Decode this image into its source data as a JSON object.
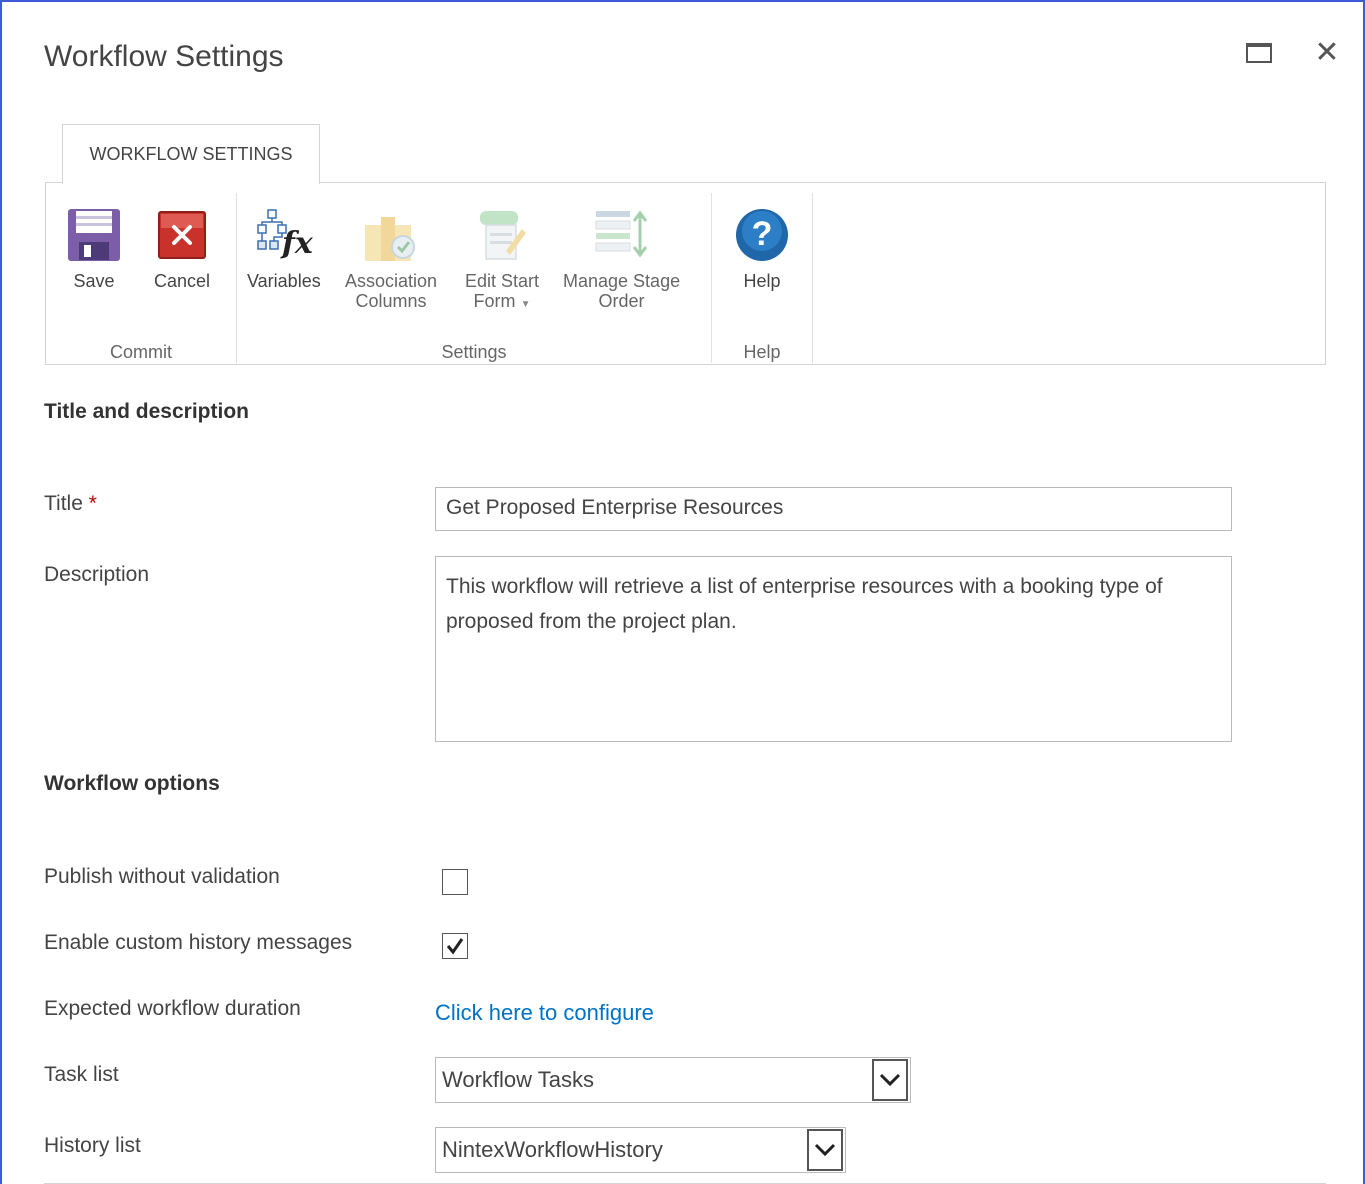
{
  "dialog": {
    "title": "Workflow Settings",
    "maximize_icon": "maximize-icon",
    "close_icon": "close-icon",
    "close_glyph": "✕"
  },
  "ribbon": {
    "tab_label": "WORKFLOW SETTINGS",
    "groups": {
      "commit": {
        "label": "Commit",
        "save_label": "Save",
        "cancel_label": "Cancel"
      },
      "settings": {
        "label": "Settings",
        "variables_label": "Variables",
        "association_columns_label_1": "Association",
        "association_columns_label_2": "Columns",
        "edit_start_form_label_1": "Edit Start",
        "edit_start_form_label_2": "Form",
        "manage_stage_order_label_1": "Manage Stage",
        "manage_stage_order_label_2": "Order"
      },
      "help": {
        "label": "Help",
        "help_label": "Help"
      }
    }
  },
  "form": {
    "title_description_heading": "Title and description",
    "title_label": "Title",
    "required_marker": "*",
    "title_value": "Get Proposed Enterprise Resources",
    "description_label": "Description",
    "description_value": "This workflow will retrieve a list of enterprise resources with a booking type of proposed from the project plan.",
    "workflow_options_heading": "Workflow options",
    "publish_without_validation_label": "Publish without validation",
    "publish_without_validation_checked": false,
    "enable_custom_history_label": "Enable custom history messages",
    "enable_custom_history_checked": true,
    "expected_duration_label": "Expected workflow duration",
    "expected_duration_link": "Click here to configure",
    "task_list_label": "Task list",
    "task_list_value": "Workflow Tasks",
    "history_list_label": "History list",
    "history_list_value": "NintexWorkflowHistory"
  },
  "colors": {
    "accent_link": "#0072c6",
    "dialog_border": "#3b5bdb",
    "required": "#bf0000"
  }
}
